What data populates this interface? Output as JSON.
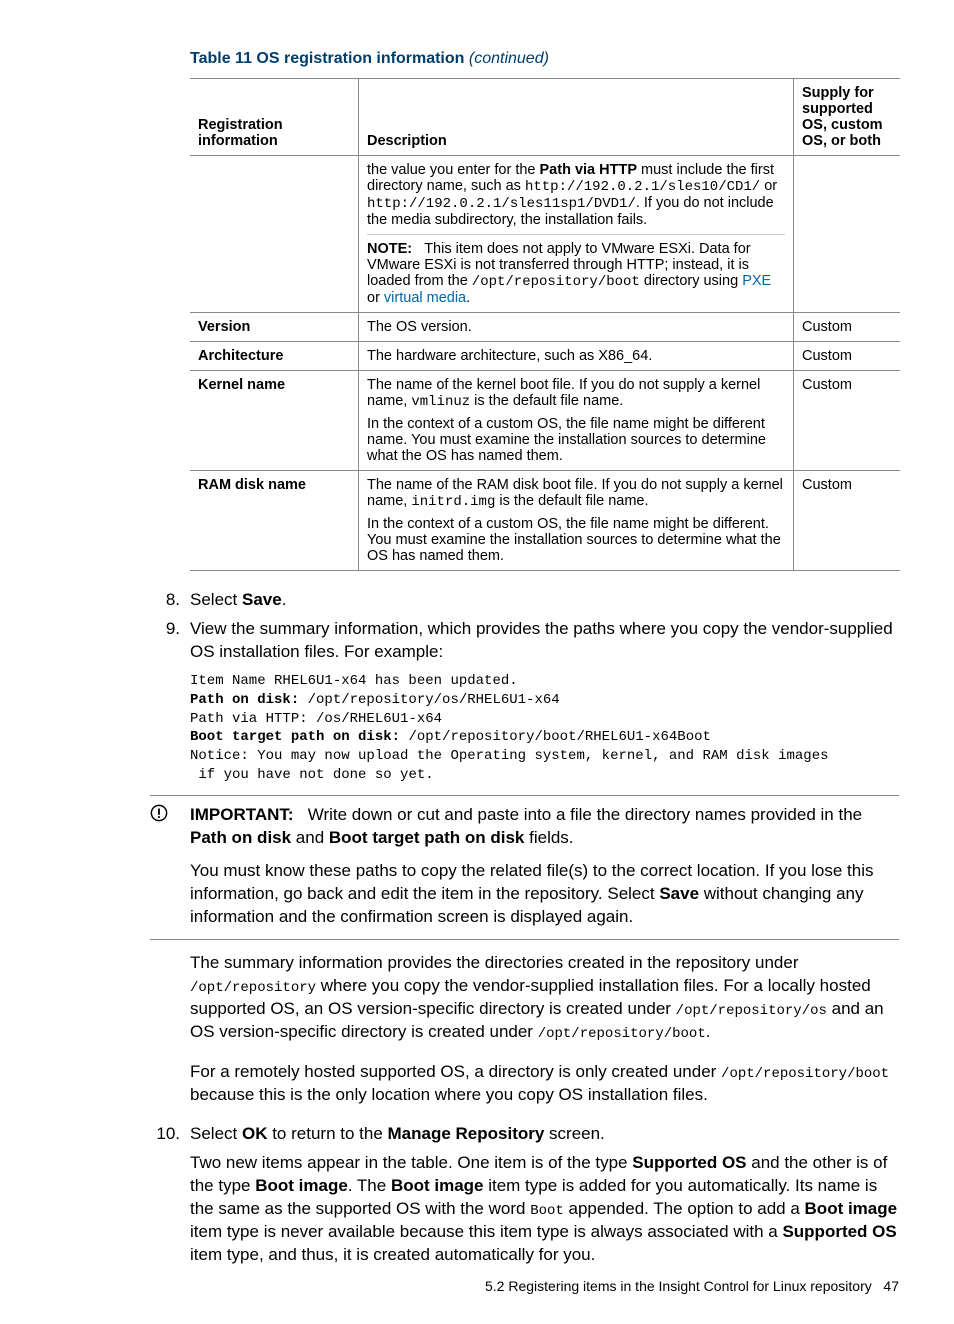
{
  "caption": {
    "title": "Table 11 OS registration information",
    "continued": "(continued)"
  },
  "table": {
    "headers": {
      "col1": "Registration information",
      "col2": "Description",
      "col3": "Supply for supported OS, custom OS, or both"
    },
    "row_http": {
      "desc_1a": "the value you enter for the ",
      "desc_1b": "Path via HTTP",
      "desc_1c": " must include the first directory name, such as ",
      "desc_1_code1": "http://192.0.2.1/sles10/CD1/",
      "desc_1d": " or ",
      "desc_1_code2": "http://192.0.2.1/sles11sp1/DVD1/",
      "desc_1e": ". If you do not include the media subdirectory, the installation fails.",
      "note_label": "NOTE:",
      "note_text1": "This item does not apply to VMware ESXi. Data for VMware ESXi is not transferred through HTTP; instead, it is loaded from the ",
      "note_code": "/opt/repository/boot",
      "note_text2": " directory using ",
      "note_link1": "PXE",
      "note_text3": " or ",
      "note_link2": "virtual media",
      "note_text4": "."
    },
    "row_version": {
      "name": "Version",
      "desc": "The OS version.",
      "supply": "Custom"
    },
    "row_arch": {
      "name": "Architecture",
      "desc": "The hardware architecture, such as X86_64.",
      "supply": "Custom"
    },
    "row_kernel": {
      "name": "Kernel name",
      "desc_1a": "The name of the kernel boot file. If you do not supply a kernel name, ",
      "desc_1_code": "vmlinuz",
      "desc_1b": " is the default file name.",
      "desc_2": "In the context of a custom OS, the file name might be different name. You must examine the installation sources to determine what the OS has named them.",
      "supply": "Custom"
    },
    "row_ram": {
      "name": "RAM disk name",
      "desc_1a": "The name of the RAM disk boot file. If you do not supply a kernel name, ",
      "desc_1_code": "initrd.img",
      "desc_1b": " is the default file name.",
      "desc_2": "In the context of a custom OS, the file name might be different. You must examine the installation sources to determine what the OS has named them.",
      "supply": "Custom"
    }
  },
  "steps": {
    "s8_num": "8.",
    "s8_a": "Select ",
    "s8_b": "Save",
    "s8_c": ".",
    "s9_num": "9.",
    "s9_text": "View the summary information, which provides the paths where you copy the vendor-supplied OS installation files. For example:",
    "s9_code": "Item Name RHEL6U1-x64 has been updated.\nPath on disk: /opt/repository/os/RHEL6U1-x64\nPath via HTTP: /os/RHEL6U1-x64\nBoot target path on disk: /opt/repository/boot/RHEL6U1-x64Boot\nNotice: You may now upload the Operating system, kernel, and RAM disk images\n if you have not done so yet.",
    "s9_code_bold_lines": [
      "Path on disk:",
      "Boot target path on disk:"
    ],
    "important_label": "IMPORTANT:",
    "important_1a": "Write down or cut and paste into a file the directory names provided in the ",
    "important_1b": "Path on disk",
    "important_1c": " and ",
    "important_1d": "Boot target path on disk",
    "important_1e": " fields.",
    "important_2a": "You must know these paths to copy the related file(s) to the correct location. If you lose this information, go back and edit the item in the repository. Select ",
    "important_2b": "Save",
    "important_2c": " without changing any information and the confirmation screen is displayed again.",
    "s9_p1a": "The summary information provides the directories created in the repository under ",
    "s9_p1_code1": "/opt/repository",
    "s9_p1b": " where you copy the vendor-supplied installation files. For a locally hosted supported OS, an OS version-specific directory is created under ",
    "s9_p1_code2": "/opt/repository/os",
    "s9_p1c": " and an OS version-specific directory is created under ",
    "s9_p1_code3": "/opt/repository/boot",
    "s9_p1d": ".",
    "s9_p2a": "For a remotely hosted supported OS, a directory is only created under ",
    "s9_p2_code": "/opt/repository/boot",
    "s9_p2b": " because this is the only location where you copy OS installation files.",
    "s10_num": "10.",
    "s10_a": "Select ",
    "s10_b": "OK",
    "s10_c": " to return to the ",
    "s10_d": "Manage Repository",
    "s10_e": " screen.",
    "s10_p1a": "Two new items appear in the table. One item is of the type ",
    "s10_p1b": "Supported OS",
    "s10_p1c": " and the other is of the type ",
    "s10_p1d": "Boot image",
    "s10_p1e": ". The ",
    "s10_p1f": "Boot image",
    "s10_p1g": " item type is added for you automatically. Its name is the same as the supported OS with the word ",
    "s10_p1_code": "Boot",
    "s10_p1h": " appended. The option to add a ",
    "s10_p1i": "Boot image",
    "s10_p1j": " item type is never available because this item type is always associated with a ",
    "s10_p1k": "Supported OS",
    "s10_p1l": " item type, and thus, it is created automatically for you."
  },
  "footer": {
    "section": "5.2 Registering items in the Insight Control for Linux repository",
    "page": "47"
  }
}
